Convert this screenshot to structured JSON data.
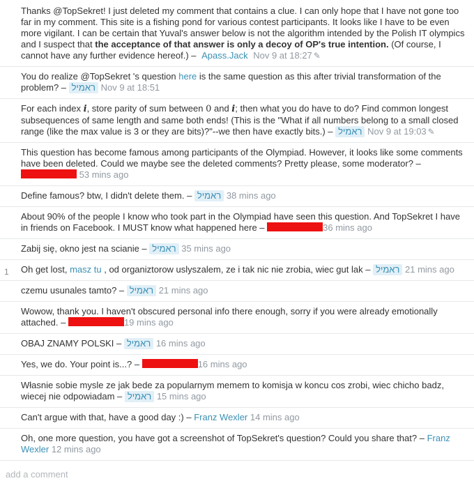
{
  "comments": [
    {
      "score": "",
      "text1": "Thanks @TopSekret! I just deleted my comment that contains a clue. I can only hope that I have not gone too far in my comment. This site is a fishing pond for various contest participants. It looks like I have to be even more vigilant. I can be certain that Yuval's answer below is not the algorithm intended by the Polish IT olympics and I suspect that ",
      "bold": "the acceptance of that answer is only a decoy of OP's true intention.",
      "text2": " (Of course, I cannot have any further evidence hereof.) – ",
      "user": "Apass.Jack",
      "date": "Nov 9 at 18:27",
      "edit_icon": "pencil-icon"
    },
    {
      "text1": "You do realize @TopSekret 's question ",
      "link": "here",
      "text2": " is the same question as this after trivial transformation of the problem? – ",
      "user": "ראמיל",
      "date": "Nov 9 at 18:51"
    },
    {
      "t1": "For each index ",
      "m1": "i",
      "t2": ", store parity of sum between ",
      "m2": "0",
      "t3": " and ",
      "m3": "i",
      "t4": "; then what you do have to do? Find common longest subsequences of same length and same both ends! (This is the \"What if all numbers belong to a small closed range (like the max value is 3 or they are bits)?\"--we then have exactly bits.) – ",
      "user": "ראמיל",
      "date": "Nov 9 at 19:03",
      "edit_icon": "pencil-icon"
    },
    {
      "text": "This question has become famous among participants of the Olympiad. However, it looks like some comments have been deleted. Could we maybe see the deleted comments? Pretty please, some moderator? – ",
      "date": "53 mins ago"
    },
    {
      "text": "Define famous? btw, I didn't delete them. – ",
      "user": "ראמיל",
      "date": "38 mins ago"
    },
    {
      "text": "About 90% of the people I know who took part in the Olympiad have seen this question. And TopSekret I have in friends on Facebook. I MUST know what happened here – ",
      "date": "36 mins ago"
    },
    {
      "text": "Zabij się, okno jest na scianie – ",
      "user": "ראמיל",
      "date": "35 mins ago"
    },
    {
      "score": "1",
      "text1": "Oh get lost, ",
      "link": "masz tu",
      "text2": " , od organiztorow uslyszalem, ze i tak nic nie zrobia, wiec gut lak – ",
      "user": "ראמיל",
      "date": "21 mins ago"
    },
    {
      "text": "czemu usunales tamto? – ",
      "user": "ראמיל",
      "date": "21 mins ago"
    },
    {
      "text": "Wowow, thank you. I haven't obscured personal info there enough, sorry if you were already emotionally attached. – ",
      "date": "19 mins ago"
    },
    {
      "text": "OBAJ ZNAMY POLSKI – ",
      "user": "ראמיל",
      "date": "16 mins ago"
    },
    {
      "text": "Yes, we do. Your point is...? – ",
      "date": "16 mins ago"
    },
    {
      "text": "Własnie sobie mysle ze jak bede za popularnym memem to komisja w koncu cos zrobi, wiec chicho badz, wiecej nie odpowiadam – ",
      "user": "ראמיל",
      "date": "15 mins ago"
    },
    {
      "text": "Can't argue with that, have a good day :) – ",
      "user": "Franz Wexler",
      "date": "14 mins ago"
    },
    {
      "text": "Oh, one more question, you have got a screenshot of TopSekret's question? Could you share that? – ",
      "user": "Franz Wexler",
      "date": "12 mins ago"
    }
  ],
  "add_comment_label": "add a comment",
  "colors": {
    "link": "#3a90b5",
    "date": "#9199a1",
    "highlight": "#e1eff7",
    "redaction": "#ee1111"
  }
}
